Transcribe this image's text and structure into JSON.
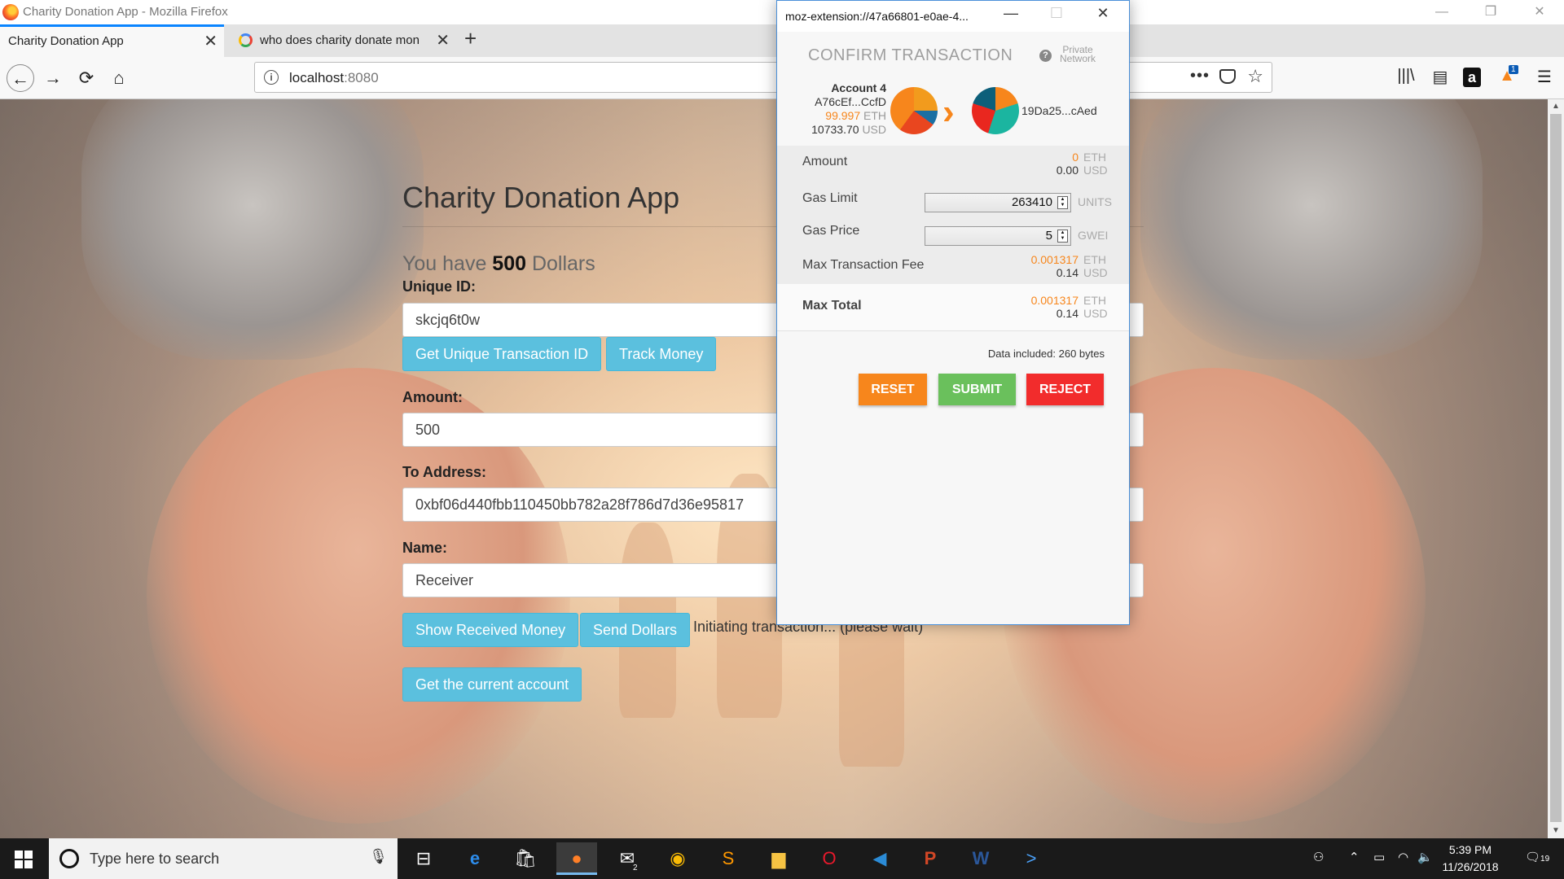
{
  "window": {
    "title": "Charity Donation App - Mozilla Firefox",
    "minimize": "—",
    "restore": "❐",
    "close": "✕"
  },
  "tabs": [
    {
      "label": "Charity Donation App",
      "close": "✕"
    },
    {
      "label": "who does charity donate mone",
      "close": "✕"
    }
  ],
  "new_tab": "+",
  "nav": {
    "back": "←",
    "forward": "→",
    "reload": "⟳",
    "home": "⌂"
  },
  "url": {
    "host": "localhost",
    "port": ":8080",
    "info": "i",
    "more": "•••",
    "star": "☆"
  },
  "toolbar": {
    "library": "|||\\",
    "sidebar": "▤",
    "amazon": "a",
    "ext_badge": "1",
    "menu": "☰"
  },
  "app": {
    "title": "Charity Donation App",
    "balance_prefix": "You have ",
    "balance_amount": "500",
    "balance_suffix": " Dollars",
    "unique_id_label": "Unique ID:",
    "unique_id_value": "skcjq6t0w",
    "get_id_button": "Get Unique Transaction ID",
    "track_button": "Track Money",
    "amount_label": "Amount:",
    "amount_value": "500",
    "address_label": "To Address:",
    "address_value": "0xbf06d440fbb110450bb782a28f786d7d36e95817",
    "name_label": "Name:",
    "name_value": "Receiver",
    "show_received_button": "Show Received Money",
    "send_button": "Send Dollars",
    "status": "Initiating transaction... (please wait)",
    "current_account_button": "Get the current account"
  },
  "metamask": {
    "window_title": "moz-extension://47a66801-e0ae-4...",
    "header": "CONFIRM TRANSACTION",
    "help": "?",
    "network_line1": "Private",
    "network_line2": "Network",
    "from": {
      "name": "Account 4",
      "address": "A76cEf...CcfD",
      "eth": "99.997",
      "eth_unit": "ETH",
      "usd": "10733.70",
      "usd_unit": "USD"
    },
    "to_address": "19Da25...cAed",
    "amount_label": "Amount",
    "amount_eth": "0",
    "amount_usd": "0.00",
    "gas_limit_label": "Gas Limit",
    "gas_limit": "263410",
    "gas_limit_unit": "UNITS",
    "gas_price_label": "Gas Price",
    "gas_price": "5",
    "gas_price_unit": "GWEI",
    "fee_label": "Max Transaction Fee",
    "fee_eth": "0.001317",
    "fee_usd": "0.14",
    "total_label": "Max Total",
    "total_eth": "0.001317",
    "total_usd": "0.14",
    "eth_unit": "ETH",
    "usd_unit": "USD",
    "data_included": "Data included: 260 bytes",
    "reset": "RESET",
    "submit": "SUBMIT",
    "reject": "REJECT",
    "colors": {
      "orange": "#f7861c",
      "reset_bg": "#f7861c",
      "submit_bg": "#6ac05c",
      "reject_bg": "#f22c2c"
    }
  },
  "taskbar": {
    "search_placeholder": "Type here to search",
    "mail_badge": "2",
    "time": "5:39 PM",
    "date": "11/26/2018",
    "notifications": "19"
  }
}
